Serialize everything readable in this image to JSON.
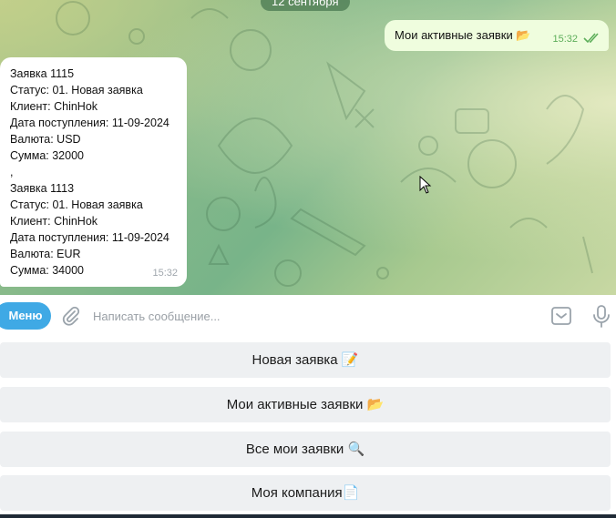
{
  "chat": {
    "date_pill": "12 сентября",
    "outgoing": {
      "text": "Мои активные заявки 📂",
      "time": "15:32"
    },
    "incoming": {
      "lines": [
        "Заявка 1115",
        "Статус: 01. Новая заявка",
        "Клиент: ChinHok",
        "Дата поступления: 11-09-2024",
        "Валюта: USD",
        "Сумма: 32000",
        ",",
        "Заявка 1113",
        "Статус: 01. Новая заявка",
        "Клиент: ChinHok",
        "Дата поступления: 11-09-2024",
        "Валюта: EUR",
        "Сумма: 34000"
      ],
      "time": "15:32"
    }
  },
  "input": {
    "menu_label": "Меню",
    "placeholder": "Написать сообщение..."
  },
  "keyboard": {
    "buttons": [
      "Новая заявка 📝",
      "Мои активные заявки 📂",
      "Все мои заявки 🔍",
      "Моя компания📄"
    ]
  },
  "colors": {
    "accent": "#3fa9e5",
    "outgoing_bubble": "#effdde",
    "outgoing_time": "#5dae5a",
    "keyboard_button": "#eef0f2"
  },
  "icons": [
    "attach-icon",
    "keyboard-icon",
    "microphone-icon",
    "double-check-icon"
  ]
}
